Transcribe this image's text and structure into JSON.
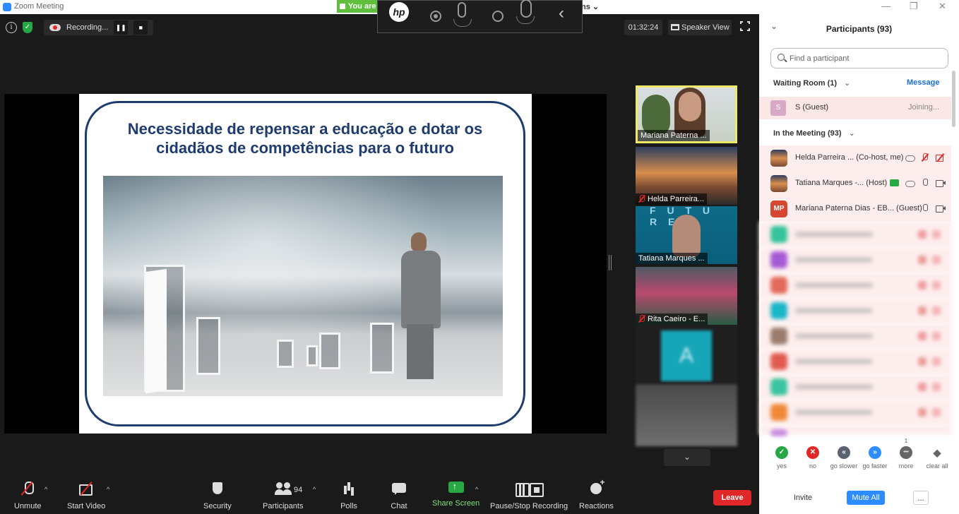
{
  "window": {
    "title": "Zoom Meeting",
    "minimize": "—",
    "restore": "❐",
    "close": "✕"
  },
  "share_banner": {
    "left_text": "You are",
    "right_text": "ns ⌄"
  },
  "hp_toolbar": {
    "logo": "hp"
  },
  "status": {
    "info": "i",
    "recording_label": "Recording...",
    "pause": "❚❚",
    "stop": "■"
  },
  "timer": "01:32:24",
  "view_button": "Speaker View",
  "slide": {
    "title": "Necessidade de repensar a educação e dotar os cidadãos de competências para o futuro"
  },
  "thumbnails": [
    {
      "name": "Mariana Paterna ...",
      "muted": false,
      "active": true
    },
    {
      "name": "Helda Parreira...",
      "muted": true
    },
    {
      "name": "Tatiana Marques ...",
      "muted": false,
      "overlay": "F U T U R E"
    },
    {
      "name": "Rita Caeiro - E...",
      "muted": true
    },
    {
      "name": "",
      "avatar_letter": "A"
    },
    {
      "name": ""
    }
  ],
  "thumb_more": "⌄",
  "toolbar": {
    "unmute": "Unmute",
    "start_video": "Start Video",
    "security": "Security",
    "participants": "Participants",
    "participant_count": "94",
    "polls": "Polls",
    "chat": "Chat",
    "share_screen": "Share Screen",
    "pause_stop": "Pause/Stop Recording",
    "reactions": "Reactions",
    "leave": "Leave",
    "caret": "^"
  },
  "panel": {
    "title": "Participants (93)",
    "collapse": "⌄",
    "search_placeholder": "Find a participant",
    "waiting_room": "Waiting Room (1)",
    "message": "Message",
    "waiting": {
      "avatar": "S",
      "name": "S (Guest)",
      "status": "Joining..."
    },
    "in_meeting": "In the Meeting (93)",
    "participants": [
      {
        "name": "Helda Parreira ... (Co-host, me)"
      },
      {
        "name": "Tatiana Marques -... (Host)"
      },
      {
        "avatar": "MP",
        "name": "Mariana Paterna Dias - EB... (Guest)"
      }
    ],
    "feedback": [
      {
        "label": "yes",
        "glyph": "✓",
        "color": "#28a745"
      },
      {
        "label": "no",
        "glyph": "✕",
        "color": "#e02828"
      },
      {
        "label": "go slower",
        "glyph": "«",
        "color": "#5a6170"
      },
      {
        "label": "go faster",
        "glyph": "»",
        "color": "#2d8cff"
      },
      {
        "label": "more",
        "glyph": "•••",
        "color": "#666666",
        "count": "1"
      },
      {
        "label": "clear all",
        "glyph": "◆",
        "color": "#666666"
      }
    ],
    "invite": "Invite",
    "mute_all": "Mute All",
    "more_btn": "..."
  }
}
